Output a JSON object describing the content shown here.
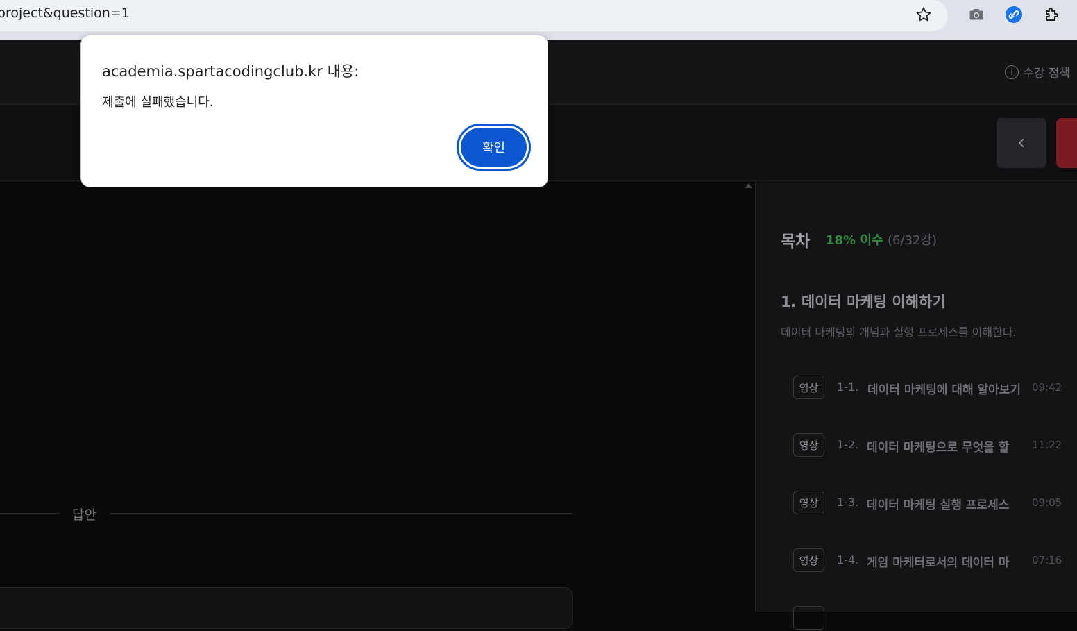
{
  "browser": {
    "url": "=project&question=1",
    "icons": [
      "star-icon",
      "camera-icon",
      "link-extension-icon",
      "puzzle-extension-icon"
    ]
  },
  "header": {
    "policy_label": "수강 정책"
  },
  "answer": {
    "label": "답안"
  },
  "toc": {
    "title": "목차",
    "progress": "18% 이수",
    "count": "(6/32강)",
    "section": {
      "title": "1. 데이터 마케팅 이해하기",
      "description": "데이터 마케팅의 개념과 실행 프로세스를 이해한다."
    },
    "lessons": [
      {
        "badge": "영상",
        "num": "1-1.",
        "name": "데이터 마케팅에 대해 알아보기",
        "time": "09:42"
      },
      {
        "badge": "영상",
        "num": "1-2.",
        "name": "데이터 마케팅으로 무엇을 할",
        "time": "11:22"
      },
      {
        "badge": "영상",
        "num": "1-3.",
        "name": "데이터 마케팅 실행 프로세스",
        "time": "09:05"
      },
      {
        "badge": "영상",
        "num": "1-4.",
        "name": "게임 마케터로서의 데이터 마",
        "time": "07:16"
      }
    ]
  },
  "dialog": {
    "title": "academia.spartacodingclub.kr 내용:",
    "message": "제출에 실패했습니다.",
    "ok_label": "확인"
  },
  "colors": {
    "accent": "#0b57d0",
    "progress_green": "#2f8a3e",
    "danger": "#7a1a22"
  }
}
